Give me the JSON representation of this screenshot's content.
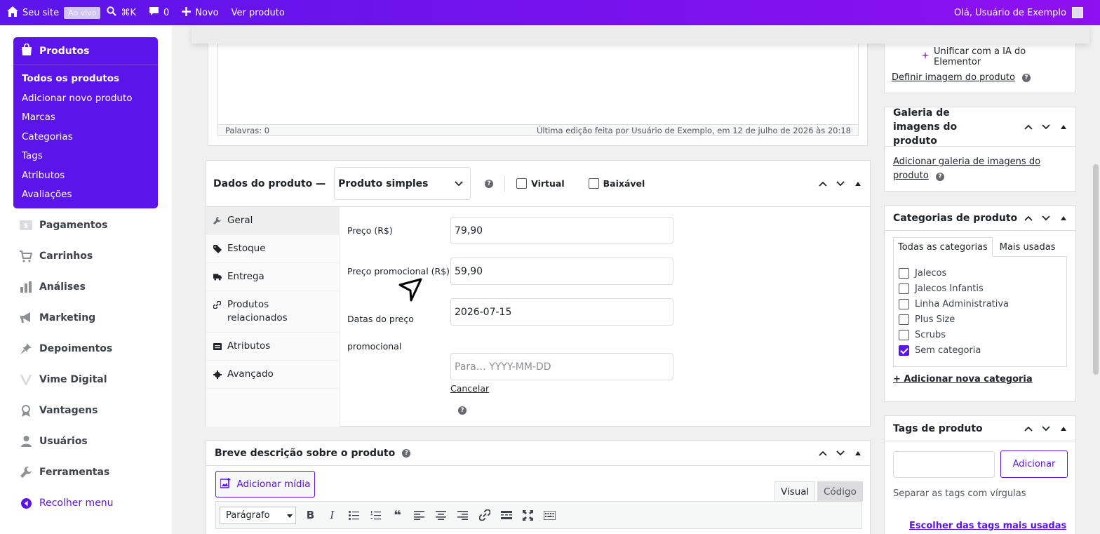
{
  "adminbar": {
    "site": "Seu site",
    "live": "Ao vivo",
    "search": "⌘K",
    "comments": "0",
    "new": "Novo",
    "view": "Ver produto",
    "greeting": "Olá, Usuário de Exemplo"
  },
  "sidebar": {
    "products": {
      "title": "Produtos",
      "items": [
        "Todos os produtos",
        "Adicionar novo produto",
        "Marcas",
        "Categorias",
        "Tags",
        "Atributos",
        "Avaliações"
      ]
    },
    "menu": [
      "Pagamentos",
      "Carrinhos",
      "Análises",
      "Marketing",
      "Depoimentos",
      "Vime Digital",
      "Vantagens",
      "Usuários",
      "Ferramentas"
    ],
    "collapse": "Recolher menu"
  },
  "editor": {
    "words": "Palavras: 0",
    "last_edit": "Última edição feita por Usuário de Exemplo, em 12 de julho de 2026 às 20:18"
  },
  "product_data": {
    "title": "Dados do produto —",
    "type": "Produto simples",
    "virtual": "Virtual",
    "downloadable": "Baixável",
    "tabs": [
      "Geral",
      "Estoque",
      "Entrega",
      "Produtos relacionados",
      "Atributos",
      "Avançado"
    ],
    "fields": {
      "price_label": "Preço (R$)",
      "price_value": "79,90",
      "sale_label": "Preço promocional (R$)",
      "sale_value": "59,90",
      "dates_label": "Datas do preço promocional",
      "date_from": "2026-07-15",
      "date_to_placeholder": "Para…  YYYY-MM-DD",
      "cancel": "Cancelar"
    }
  },
  "short_desc": {
    "title": "Breve descrição sobre o produto",
    "add_media": "Adicionar mídia",
    "visual": "Visual",
    "code": "Código",
    "format": "Parágrafo"
  },
  "right": {
    "ai_link": "Unificar com a IA do Elementor",
    "set_image": "Definir imagem do produto",
    "gallery_title": "Galeria de imagens do produto",
    "gallery_link": "Adicionar galeria de imagens do produto",
    "categories_title": "Categorias de produto",
    "cat_tab_all": "Todas as categorias",
    "cat_tab_used": "Mais usadas",
    "categories": [
      {
        "name": "Jalecos",
        "checked": false
      },
      {
        "name": "Jalecos Infantis",
        "checked": false
      },
      {
        "name": "Linha Administrativa",
        "checked": false
      },
      {
        "name": "Plus Size",
        "checked": false
      },
      {
        "name": "Scrubs",
        "checked": false
      },
      {
        "name": "Sem categoria",
        "checked": true
      }
    ],
    "add_category": "+ Adicionar nova categoria",
    "tags_title": "Tags de produto",
    "tags_add": "Adicionar",
    "tags_hint": "Separar as tags com vírgulas",
    "tags_popular": "Escolher das tags mais usadas"
  },
  "colors": {
    "accent": "#5b15ea",
    "bar_gradient_end": "#8f10f0"
  }
}
